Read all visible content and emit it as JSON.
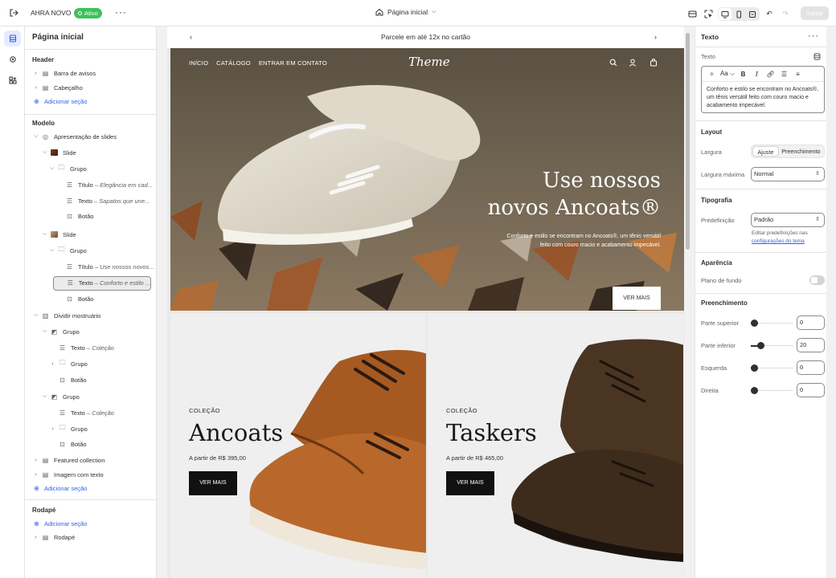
{
  "topbar": {
    "store_name": "AHRA NOVO",
    "status_badge": "Ativo",
    "page_selector": "Página inicial",
    "save_label": "Salvar"
  },
  "sidebar": {
    "title": "Página inicial",
    "header_label": "Header",
    "header_items": [
      "Barra de avisos",
      "Cabeçalho"
    ],
    "add_section": "Adicionar seção",
    "template_label": "Modelo",
    "slideshow": "Apresentação de slides",
    "slide": "Slide",
    "group": "Grupo",
    "title_item": "Título",
    "text_item": "Texto",
    "button_item": "Botão",
    "slide1_title_sub": "Elegância em cad...",
    "slide1_text_sub": "Sapatos que une...",
    "slide2_title_sub": "Use nossos novos...",
    "slide2_text_sub": "Conforto e estilo ...",
    "split_showcase": "Dividir mostruário",
    "collection_sub": "Coleção",
    "featured_collection": "Featured collection",
    "image_with_text": "Imagem com texto",
    "footer_label": "Rodapé",
    "footer_item": "Rodapé",
    "dash": "–"
  },
  "preview": {
    "announcement": "Parcele em até 12x no cartão",
    "nav": [
      "INÍCIO",
      "CATÁLOGO",
      "ENTRAR EM CONTATO"
    ],
    "logo": "Theme",
    "hero_title_1": "Use nossos",
    "hero_title_2": "novos Ancoats®",
    "hero_text": "Conforto e estilo se encontram no Ancoats®, um tênis versátil feito com couro macio e acabamento impecável.",
    "hero_button": "VER MAIS",
    "collection_kicker": "COLEÇÃO",
    "col1_title": "Ancoats",
    "col1_price": "A partir de R$ 395,00",
    "col2_title": "Taskers",
    "col2_price": "A partir de R$ 465,00",
    "col_button": "VER MAIS"
  },
  "settings": {
    "panel_title": "Texto",
    "text_label": "Texto",
    "editor_content": "Conforto e estilo se encontram no Ancoats®, um tênis versátil feito com couro macio e acabamento impecável.",
    "layout": "Layout",
    "width_label": "Largura",
    "width_options": [
      "Ajuste",
      "Preenchimento"
    ],
    "max_width_label": "Largura máxima",
    "max_width_value": "Normal",
    "typography": "Tipografia",
    "preset_label": "Predefinição",
    "preset_value": "Padrão",
    "preset_hint": "Editar predefinições nas",
    "preset_hint_link": "configurações do tema",
    "appearance": "Aparência",
    "background_label": "Plano de fundo",
    "padding": "Preenchimento",
    "pad_top_label": "Parte superior",
    "pad_top": "0",
    "pad_bottom_label": "Parte inferior",
    "pad_bottom": "20",
    "pad_left_label": "Esquerda",
    "pad_left": "0",
    "pad_right_label": "Direita",
    "pad_right": "0"
  },
  "colors": {
    "accent": "#2f5ee5",
    "status": "#3ec15a",
    "button_dark": "#111111"
  }
}
